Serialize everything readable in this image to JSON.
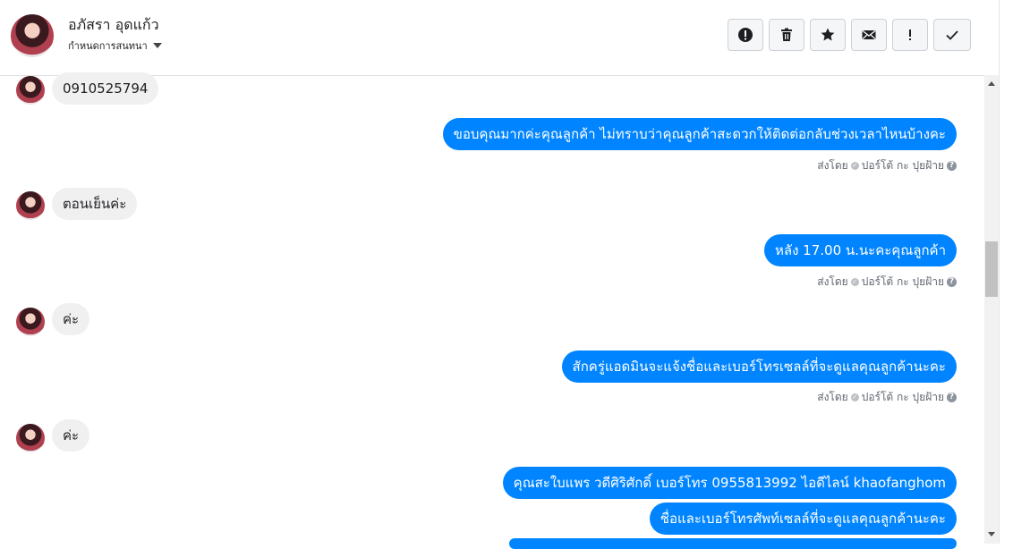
{
  "header": {
    "name": "อภัสรา อุดแก้ว",
    "subtitle": "กำหนดการสนทนา",
    "actions": [
      "report-icon",
      "trash-icon",
      "star-icon",
      "mail-icon",
      "exclamation-icon",
      "check-icon"
    ]
  },
  "messages": {
    "in1": "0910525794",
    "out1": "ขอบคุณมากค่ะคุณลูกค้า ไม่ทราบว่าคุณลูกค้าสะดวกให้ติดต่อกลับช่วงเวลาไหนบ้างคะ",
    "in2": "ตอนเย็นค่ะ",
    "out2": "หลัง 17.00 น.นะคะคุณลูกค้า",
    "in3": "ค่ะ",
    "out3": "สักครู่แอดมินจะแจ้งชื่อและเบอร์โทรเซลล์ที่จะดูแลคุณลูกค้านะคะ",
    "in4": "ค่ะ",
    "out4": "คุณสะใบแพร วดีศิริศักดิ์ เบอร์โทร 0955813992  ไอดีไลน์  khaofanghom",
    "out5": "ชื่อและเบอร์โทรศัพท์เซลล์ที่จะดูแลคุณลูกค้านะคะ"
  },
  "meta": {
    "sent_by": "ส่งโดย",
    "sender": "ปอร์โต้ กะ ปุยฝ้าย"
  },
  "colors": {
    "accent": "#0084ff",
    "incoming": "#f1f0f0"
  }
}
